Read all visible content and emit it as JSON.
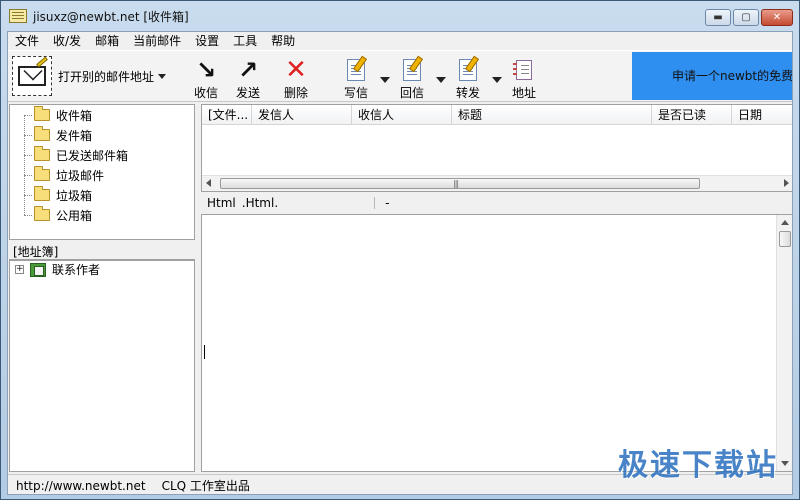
{
  "window": {
    "title": "jisuxz@newbt.net [收件箱]"
  },
  "menu": [
    "文件",
    "收/发",
    "邮箱",
    "当前邮件",
    "设置",
    "工具",
    "帮助"
  ],
  "toolbar": {
    "open_other_label": "打开别的邮件地址",
    "receive_label": "收信",
    "send_label": "发送",
    "delete_label": "删除",
    "compose_label": "写信",
    "reply_label": "回信",
    "forward_label": "转发",
    "address_label": "地址"
  },
  "banner": {
    "text": "申请一个newbt的免费邮",
    "color": "#2f8ff0"
  },
  "folders": [
    "收件箱",
    "发件箱",
    "已发送邮件箱",
    "垃圾邮件",
    "垃圾箱",
    "公用箱"
  ],
  "address_book": {
    "header": "[地址簿]",
    "contact_group": "联系作者",
    "expander": "+"
  },
  "message_list": {
    "columns": [
      "[文件...",
      "发信人",
      "收信人",
      "标题",
      "是否已读",
      "日期"
    ],
    "rows": []
  },
  "preview_bar": {
    "format_label": "Html",
    "format_file": ".Html.",
    "info": "-"
  },
  "statusbar": {
    "url": "http://www.newbt.net",
    "credit": "CLQ 工作室出品"
  },
  "watermark": "极速下载站"
}
